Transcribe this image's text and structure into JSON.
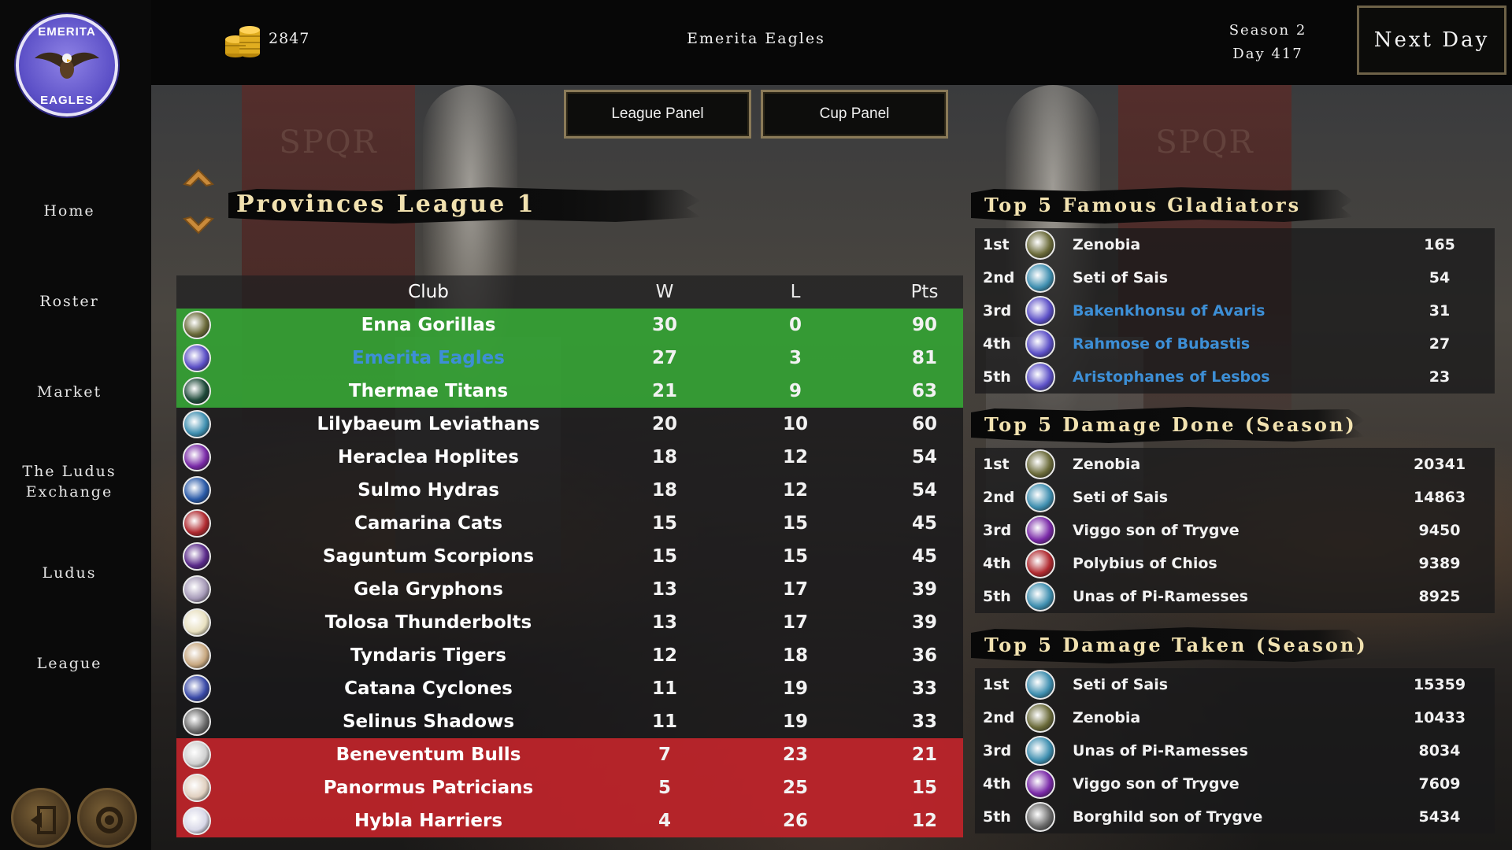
{
  "sidebar": {
    "logo": {
      "top_text": "EMERITA",
      "bottom_text": "EAGLES"
    },
    "items": [
      {
        "label": "Home"
      },
      {
        "label": "Roster"
      },
      {
        "label": "Market"
      },
      {
        "label": "The Ludus Exchange"
      },
      {
        "label": "Ludus"
      },
      {
        "label": "League"
      }
    ],
    "bottom_buttons": [
      {
        "icon": "exit-door-icon"
      },
      {
        "icon": "settings-gear-icon"
      }
    ]
  },
  "topbar": {
    "gold": "2847",
    "coin_icon": "gold-coins-icon",
    "club_name": "Emerita Eagles",
    "season": "Season 2",
    "day": "Day 417",
    "next_day_label": "Next Day"
  },
  "panel_tabs": {
    "league_label": "League Panel",
    "cup_label": "Cup Panel"
  },
  "league": {
    "title": "Provinces League 1",
    "columns": {
      "club": "Club",
      "w": "W",
      "l": "L",
      "pts": "Pts"
    },
    "rows": [
      {
        "club": "Enna Gorillas",
        "w": "30",
        "l": "0",
        "pts": "90",
        "zone": "promo",
        "badge_color": "#6b6b3a"
      },
      {
        "club": "Emerita Eagles",
        "w": "27",
        "l": "3",
        "pts": "81",
        "zone": "promo",
        "badge_color": "#5c50c7",
        "mine": true
      },
      {
        "club": "Thermae Titans",
        "w": "21",
        "l": "9",
        "pts": "63",
        "zone": "promo",
        "badge_color": "#1f4a3a"
      },
      {
        "club": "Lilybaeum Leviathans",
        "w": "20",
        "l": "10",
        "pts": "60",
        "zone": "",
        "badge_color": "#3f8fb0"
      },
      {
        "club": "Heraclea Hoplites",
        "w": "18",
        "l": "12",
        "pts": "54",
        "zone": "",
        "badge_color": "#7a2aa8"
      },
      {
        "club": "Sulmo Hydras",
        "w": "18",
        "l": "12",
        "pts": "54",
        "zone": "",
        "badge_color": "#2a5aa8"
      },
      {
        "club": "Camarina Cats",
        "w": "15",
        "l": "15",
        "pts": "45",
        "zone": "",
        "badge_color": "#b02a30"
      },
      {
        "club": "Saguntum Scorpions",
        "w": "15",
        "l": "15",
        "pts": "45",
        "zone": "",
        "badge_color": "#5a2a8a"
      },
      {
        "club": "Gela Gryphons",
        "w": "13",
        "l": "17",
        "pts": "39",
        "zone": "",
        "badge_color": "#a69ab8"
      },
      {
        "club": "Tolosa Thunderbolts",
        "w": "13",
        "l": "17",
        "pts": "39",
        "zone": "",
        "badge_color": "#e8e0c0"
      },
      {
        "club": "Tyndaris Tigers",
        "w": "12",
        "l": "18",
        "pts": "36",
        "zone": "",
        "badge_color": "#c8a880"
      },
      {
        "club": "Catana Cyclones",
        "w": "11",
        "l": "19",
        "pts": "33",
        "zone": "",
        "badge_color": "#3a4aa8"
      },
      {
        "club": "Selinus Shadows",
        "w": "11",
        "l": "19",
        "pts": "33",
        "zone": "",
        "badge_color": "#6a6a6a"
      },
      {
        "club": "Beneventum Bulls",
        "w": "7",
        "l": "23",
        "pts": "21",
        "zone": "releg",
        "badge_color": "#d0d0d0"
      },
      {
        "club": "Panormus Patricians",
        "w": "5",
        "l": "25",
        "pts": "15",
        "zone": "releg",
        "badge_color": "#e0d0c0"
      },
      {
        "club": "Hybla Harriers",
        "w": "4",
        "l": "26",
        "pts": "12",
        "zone": "releg",
        "badge_color": "#d8d8e8"
      }
    ]
  },
  "famous": {
    "title": "Top 5 Famous Gladiators",
    "rows": [
      {
        "rank": "1st",
        "name": "Zenobia",
        "value": "165",
        "badge_color": "#6b6b3a"
      },
      {
        "rank": "2nd",
        "name": "Seti of Sais",
        "value": "54",
        "badge_color": "#3f8fb0"
      },
      {
        "rank": "3rd",
        "name": "Bakenkhonsu of Avaris",
        "value": "31",
        "badge_color": "#5c50c7",
        "mine": true
      },
      {
        "rank": "4th",
        "name": "Rahmose of Bubastis",
        "value": "27",
        "badge_color": "#5c50c7",
        "mine": true
      },
      {
        "rank": "5th",
        "name": "Aristophanes of Lesbos",
        "value": "23",
        "badge_color": "#5c50c7",
        "mine": true
      }
    ]
  },
  "damage_done": {
    "title": "Top 5 Damage Done (Season)",
    "rows": [
      {
        "rank": "1st",
        "name": "Zenobia",
        "value": "20341",
        "badge_color": "#6b6b3a"
      },
      {
        "rank": "2nd",
        "name": "Seti of Sais",
        "value": "14863",
        "badge_color": "#3f8fb0"
      },
      {
        "rank": "3rd",
        "name": "Viggo son of Trygve",
        "value": "9450",
        "badge_color": "#7a2aa8"
      },
      {
        "rank": "4th",
        "name": "Polybius of Chios",
        "value": "9389",
        "badge_color": "#b02a30"
      },
      {
        "rank": "5th",
        "name": "Unas of Pi-Ramesses",
        "value": "8925",
        "badge_color": "#3f8fb0"
      }
    ]
  },
  "damage_taken": {
    "title": "Top 5 Damage Taken (Season)",
    "rows": [
      {
        "rank": "1st",
        "name": "Seti of Sais",
        "value": "15359",
        "badge_color": "#3f8fb0"
      },
      {
        "rank": "2nd",
        "name": "Zenobia",
        "value": "10433",
        "badge_color": "#6b6b3a"
      },
      {
        "rank": "3rd",
        "name": "Unas of Pi-Ramesses",
        "value": "8034",
        "badge_color": "#3f8fb0"
      },
      {
        "rank": "4th",
        "name": "Viggo son of Trygve",
        "value": "7609",
        "badge_color": "#7a2aa8"
      },
      {
        "rank": "5th",
        "name": "Borghild son of Trygve",
        "value": "5434",
        "badge_color": "#6a6a6a"
      }
    ]
  },
  "colors": {
    "promotion": "#34a034",
    "relegation": "#be242a",
    "own_club_text": "#3d8fd6",
    "header_text": "#f2e2b0"
  }
}
